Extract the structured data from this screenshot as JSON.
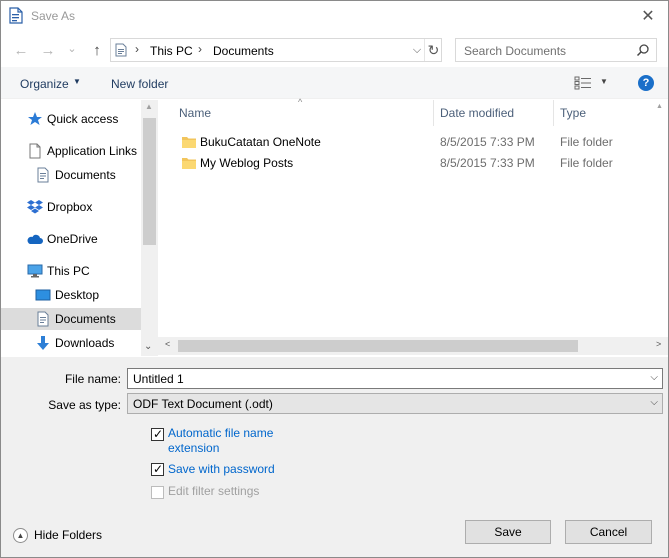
{
  "window": {
    "title": "Save As",
    "close_glyph": "✕"
  },
  "nav": {
    "back_glyph": "←",
    "forward_glyph": "→",
    "recent_glyph": "⌄",
    "up_glyph": "↑",
    "breadcrumb": [
      "This PC",
      "Documents"
    ],
    "separator": "›",
    "dropdown_glyph": "⌵",
    "refresh_glyph": "↻",
    "search_placeholder": "Search Documents"
  },
  "toolbar": {
    "organize_label": "Organize",
    "caret": "▼",
    "new_folder_label": "New folder",
    "help_label": "?"
  },
  "nav_pane": {
    "items": [
      {
        "label": "Quick access",
        "icon": "star-icon"
      },
      {
        "label": "Application Links",
        "icon": "document-icon"
      },
      {
        "label": "Documents",
        "icon": "documents-icon"
      },
      {
        "label": "Dropbox",
        "icon": "dropbox-icon"
      },
      {
        "label": "OneDrive",
        "icon": "cloud-icon"
      },
      {
        "label": "This PC",
        "icon": "computer-icon"
      },
      {
        "label": "Desktop",
        "icon": "desktop-icon"
      },
      {
        "label": "Documents",
        "icon": "documents-icon",
        "selected": true
      },
      {
        "label": "Downloads",
        "icon": "download-icon"
      }
    ],
    "scroll_up_glyph": "▲",
    "scroll_down_glyph": "⌄"
  },
  "file_list": {
    "columns": [
      "Name",
      "Date modified",
      "Type"
    ],
    "sort_glyph": "^",
    "rows": [
      {
        "name": "BukuCatatan OneNote",
        "date": "8/5/2015 7:33 PM",
        "type": "File folder"
      },
      {
        "name": "My Weblog Posts",
        "date": "8/5/2015 7:33 PM",
        "type": "File folder"
      }
    ],
    "scroll_left_glyph": "<",
    "scroll_right_glyph": ">",
    "scroll_up_glyph": "▲"
  },
  "form": {
    "file_name_label": "File name:",
    "file_name_value": "Untitled 1",
    "save_as_type_label": "Save as type:",
    "save_as_type_value": "ODF Text Document (.odt)",
    "dropdown_glyph": "⌵",
    "checkboxes": [
      {
        "label": "Automatic file name extension",
        "checked": true,
        "enabled": true
      },
      {
        "label": "Save with password",
        "checked": true,
        "enabled": true
      },
      {
        "label": "Edit filter settings",
        "checked": false,
        "enabled": false
      }
    ],
    "check_glyph": "✓"
  },
  "footer": {
    "hide_folders_label": "Hide Folders",
    "hide_folders_glyph": "▲",
    "save_label": "Save",
    "cancel_label": "Cancel"
  },
  "colors": {
    "accent": "#1a6fc9",
    "link": "#0066cc",
    "selection": "#dcdcdc",
    "panel": "#f0f0f0"
  }
}
